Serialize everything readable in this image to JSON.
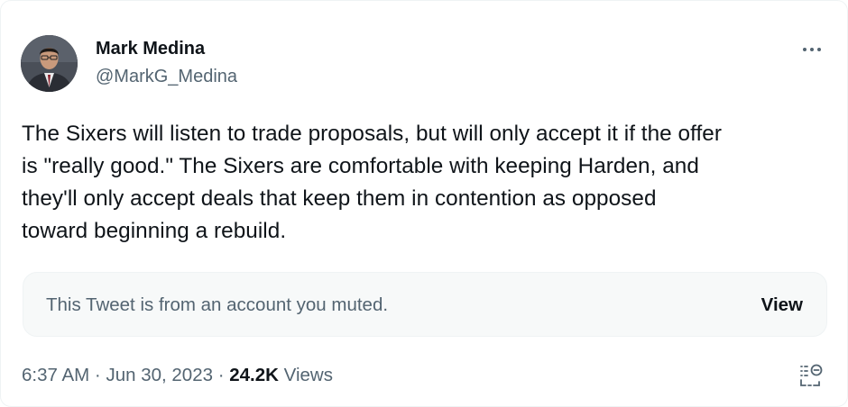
{
  "author": {
    "display_name": "Mark Medina",
    "handle": "@MarkG_Medina"
  },
  "tweet": {
    "text_lines": [
      "The Sixers will listen to trade proposals, but will only accept it if the offer",
      "is \"really good.\" The Sixers are comfortable with keeping Harden, and",
      "they'll only accept deals that keep them in contention as opposed",
      "toward beginning a rebuild."
    ]
  },
  "muted_notice": {
    "text": "This Tweet is from an account you muted.",
    "action_label": "View"
  },
  "meta": {
    "time": "6:37 AM",
    "separator": "·",
    "date": "Jun 30, 2023",
    "views_count": "24.2K",
    "views_label": "Views"
  },
  "icons": {
    "more": "more-icon",
    "summary": "summary-icon",
    "avatar": "avatar"
  },
  "colors": {
    "text_primary": "#0f1419",
    "text_secondary": "#536471",
    "muted_box_bg": "#f7f9f9",
    "border": "#eff3f4"
  }
}
